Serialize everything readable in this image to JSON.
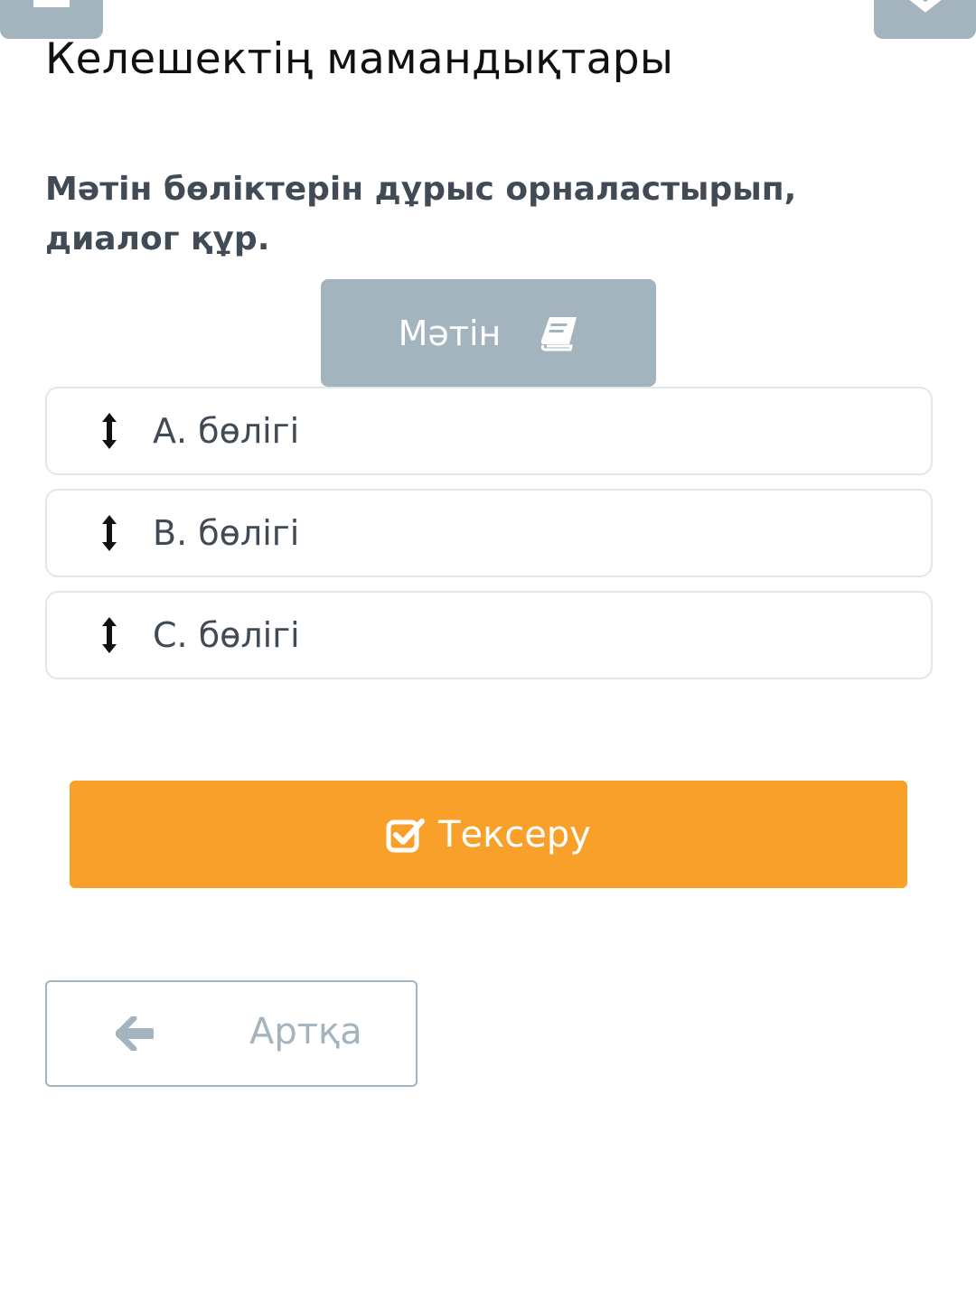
{
  "header": {
    "title": "Келешектің мамандықтары",
    "left_icon": "menu-icon",
    "right_icon": "close-icon"
  },
  "task": {
    "instruction": "Мәтін бөліктерін дұрыс орналастырып, диалог құр."
  },
  "text_button": {
    "label": "Мәтін",
    "icon": "book-icon"
  },
  "sortable_items": [
    {
      "label": "А. бөлігі",
      "icon": "drag-vertical-icon"
    },
    {
      "label": "В. бөлігі",
      "icon": "drag-vertical-icon"
    },
    {
      "label": "С. бөлігі",
      "icon": "drag-vertical-icon"
    }
  ],
  "check_button": {
    "label": "Тексеру",
    "icon": "checkbox-icon"
  },
  "back_button": {
    "label": "Артқа",
    "icon": "arrow-left-icon"
  },
  "colors": {
    "primary_gray": "#a3b4bf",
    "accent_orange": "#f9a02b",
    "text_dark": "#414b55",
    "border_light": "#e3e6ea"
  }
}
